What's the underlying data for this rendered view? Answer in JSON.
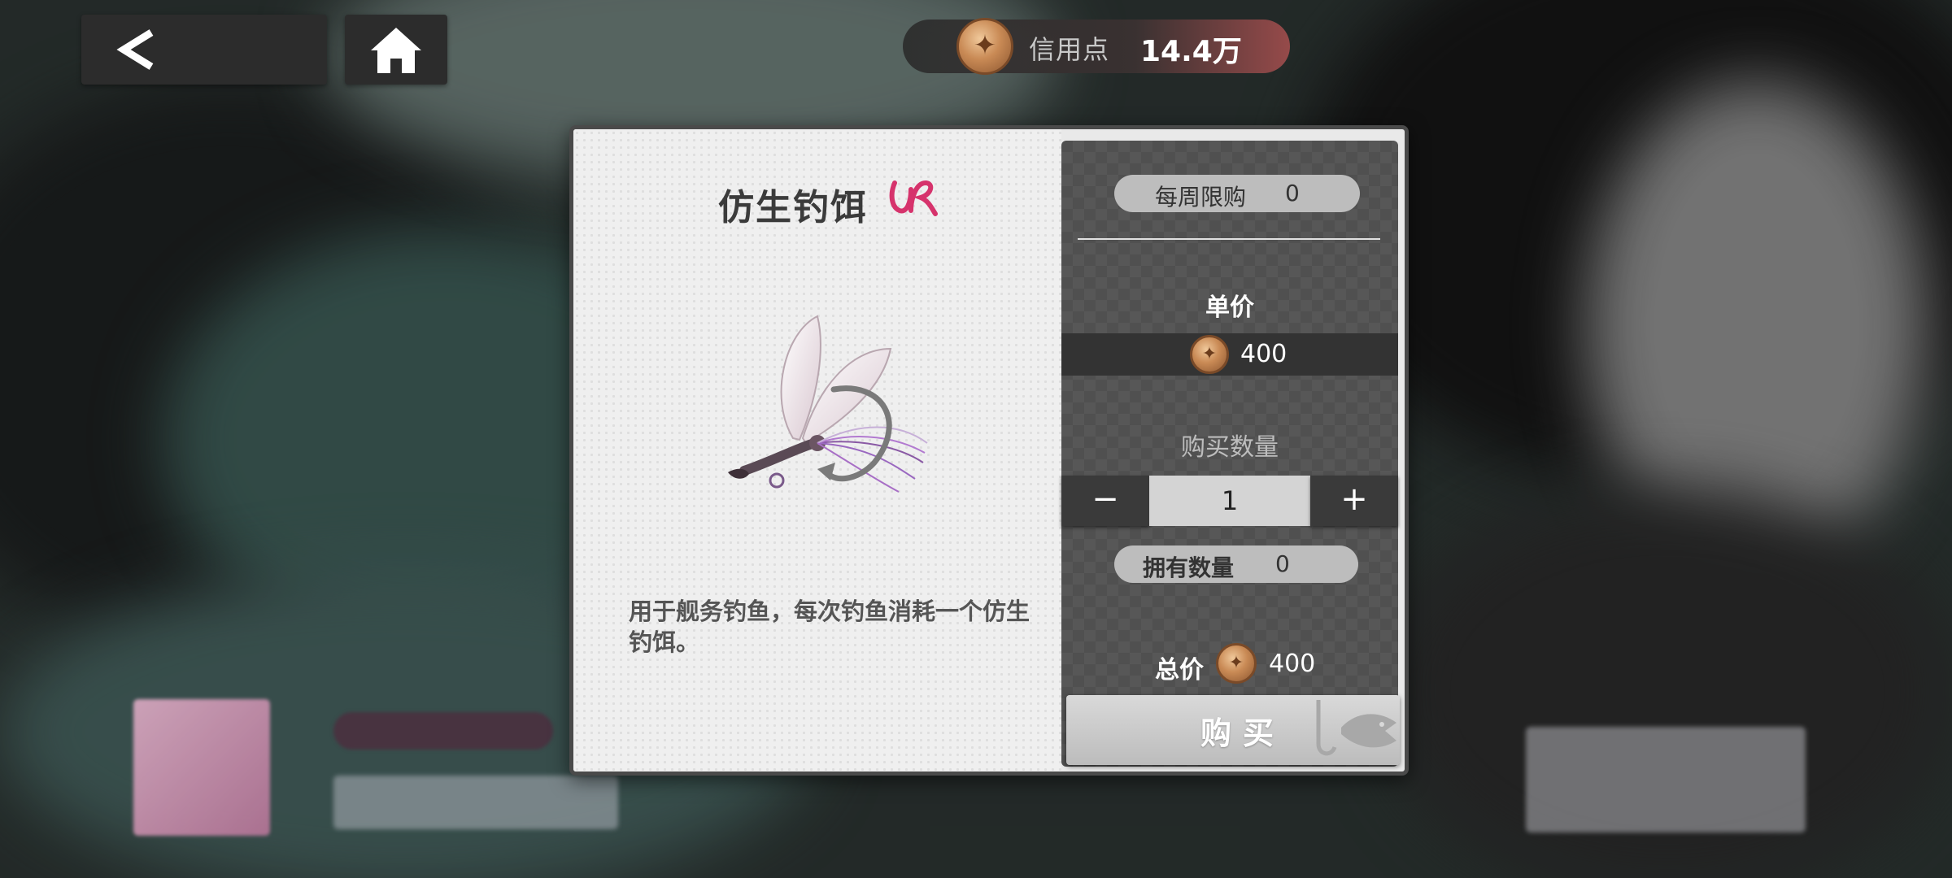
{
  "header": {
    "credit_label": "信用点",
    "credit_value": "14.4万"
  },
  "item": {
    "name": "仿生钓饵",
    "rarity": "UR",
    "description": "用于舰务钓鱼，每次钓鱼消耗一个仿生钓饵。"
  },
  "shop": {
    "weekly_limit_label": "每周限购",
    "weekly_limit_value": "0",
    "unit_price_label": "单价",
    "unit_price_value": "400",
    "quantity_label": "购买数量",
    "quantity_value": "1",
    "minus_label": "−",
    "plus_label": "+",
    "owned_label": "拥有数量",
    "owned_value": "0",
    "total_label": "总价",
    "total_value": "400",
    "buy_label": "购买"
  },
  "colors": {
    "accent_rarity": "#d6336c",
    "panel_dark": "#505050",
    "coin": "#c98a55"
  },
  "icons": {
    "back": "back-arrow-icon",
    "home": "home-icon",
    "currency": "credit-coin-icon",
    "fish": "fish-hook-icon"
  }
}
